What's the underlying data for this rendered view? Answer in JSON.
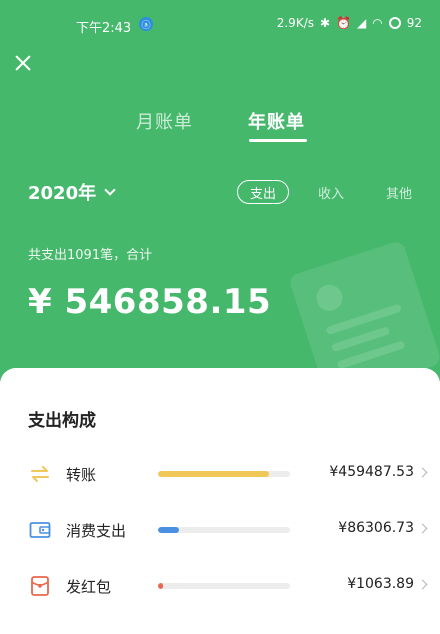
{
  "status_bar": {
    "time": "下午2:43",
    "app_icon": "ⓐ",
    "net_speed": "2.9K/s",
    "battery": "92"
  },
  "tabs": {
    "month": "月账单",
    "year": "年账单",
    "active": "year"
  },
  "year_selector": {
    "label": "2020年"
  },
  "filters": {
    "expense": "支出",
    "income": "收入",
    "other": "其他",
    "active": "expense"
  },
  "summary": {
    "label": "共支出1091笔，合计",
    "total": "¥ 546858.15"
  },
  "composition": {
    "title": "支出构成",
    "items": [
      {
        "label": "转账",
        "amount": "¥459487.53",
        "share": 0.84,
        "color": "#f0c85a",
        "icon": "transfer-icon"
      },
      {
        "label": "消费支出",
        "amount": "¥86306.73",
        "share": 0.16,
        "color": "#4a90e2",
        "icon": "wallet-icon"
      },
      {
        "label": "发红包",
        "amount": "¥1063.89",
        "share": 0.02,
        "color": "#e8674d",
        "icon": "red-packet-icon"
      }
    ]
  },
  "colors": {
    "header_green": "#45b86c",
    "card_bg": "#ffffff"
  }
}
